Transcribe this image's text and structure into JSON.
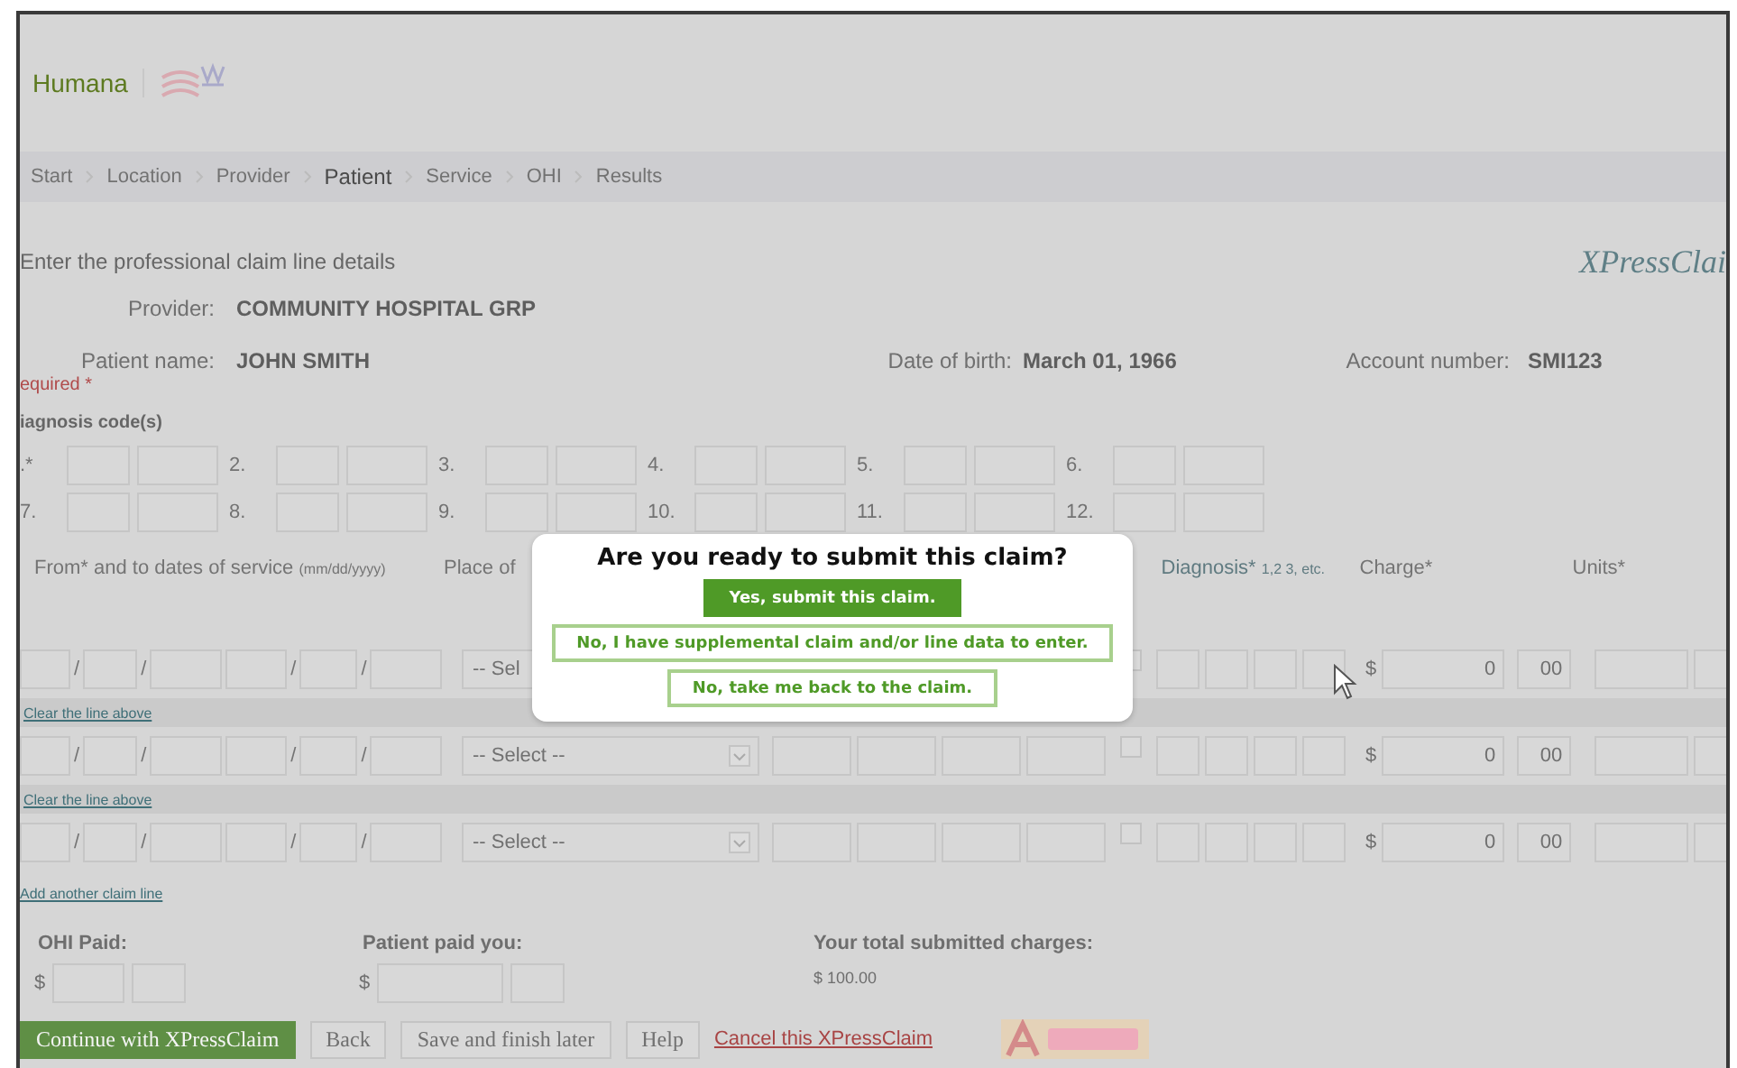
{
  "brand": {
    "name": "Humana"
  },
  "breadcrumb": [
    {
      "label": "Start",
      "selected": false
    },
    {
      "label": "Location",
      "selected": false
    },
    {
      "label": "Provider",
      "selected": false
    },
    {
      "label": "Patient",
      "selected": true
    },
    {
      "label": "Service",
      "selected": false
    },
    {
      "label": "OHI",
      "selected": false
    },
    {
      "label": "Results",
      "selected": false
    }
  ],
  "heading": "Enter the professional claim line details",
  "product_logo": "XPressClai",
  "provider": {
    "label": "Provider:",
    "value": "COMMUNITY HOSPITAL GRP"
  },
  "patient": [
    {
      "label": "Patient name:",
      "value": "JOHN SMITH"
    },
    {
      "label": "Date of birth:",
      "value": "March 01, 1966"
    },
    {
      "label": "Account number:",
      "value": "SMI123"
    }
  ],
  "required_note": "equired *",
  "diagnosis": {
    "title": "iagnosis code(s)",
    "codes": [
      ".*",
      "2.",
      "3.",
      "4.",
      "5.",
      "6.",
      "7.",
      "8.",
      "9.",
      "10.",
      "11.",
      "12."
    ]
  },
  "service": {
    "headers": [
      {
        "main": "From* and to dates of service",
        "note": "(mm/dd/yyyy)"
      },
      {
        "main": "Place of"
      },
      {
        "main": "Diagnosis*",
        "note": "1,2 3, etc."
      },
      {
        "main": "Charge*"
      },
      {
        "main": "Units*"
      }
    ],
    "lines": [
      {
        "separators": [
          "/",
          "/",
          "/",
          "/"
        ],
        "select": "-- Sel",
        "checked": false,
        "dollar": "$",
        "charge": "0",
        "cents": "00",
        "clear_link": "Clear the line above"
      },
      {
        "separators": [
          "/",
          "/",
          "/",
          "/"
        ],
        "select": "-- Select --",
        "checked": false,
        "dollar": "$",
        "charge": "0",
        "cents": "00",
        "clear_link": "Clear the line above"
      },
      {
        "separators": [
          "/",
          "/",
          "/",
          "/"
        ],
        "select": "-- Select --",
        "checked": false,
        "dollar": "$",
        "charge": "0",
        "cents": "00"
      }
    ]
  },
  "add_line_link": "Add another claim line",
  "totals": [
    {
      "label": "OHI Paid:",
      "kind": "input",
      "dollar": "$"
    },
    {
      "label": "Patient paid you:",
      "kind": "input",
      "dollar": "$"
    },
    {
      "label": "Your total submitted charges:",
      "kind": "value",
      "value": "$ 100.00"
    }
  ],
  "actions": [
    {
      "label": "Continue with XPressClaim",
      "kind": "primary"
    },
    {
      "label": "Back",
      "kind": "secondary"
    },
    {
      "label": "Save and finish later",
      "kind": "secondary"
    },
    {
      "label": "Help",
      "kind": "secondary"
    },
    {
      "label": "Cancel this XPressClaim",
      "kind": "link"
    }
  ],
  "dialog": {
    "title": "Are you ready to submit this claim?",
    "buttons": [
      {
        "label": "Yes, submit this claim.",
        "kind": "primary"
      },
      {
        "label": "No, I have supplemental claim and/or line data to enter.",
        "kind": "outline"
      },
      {
        "label": "No, take me back to the claim.",
        "kind": "outline"
      }
    ]
  }
}
